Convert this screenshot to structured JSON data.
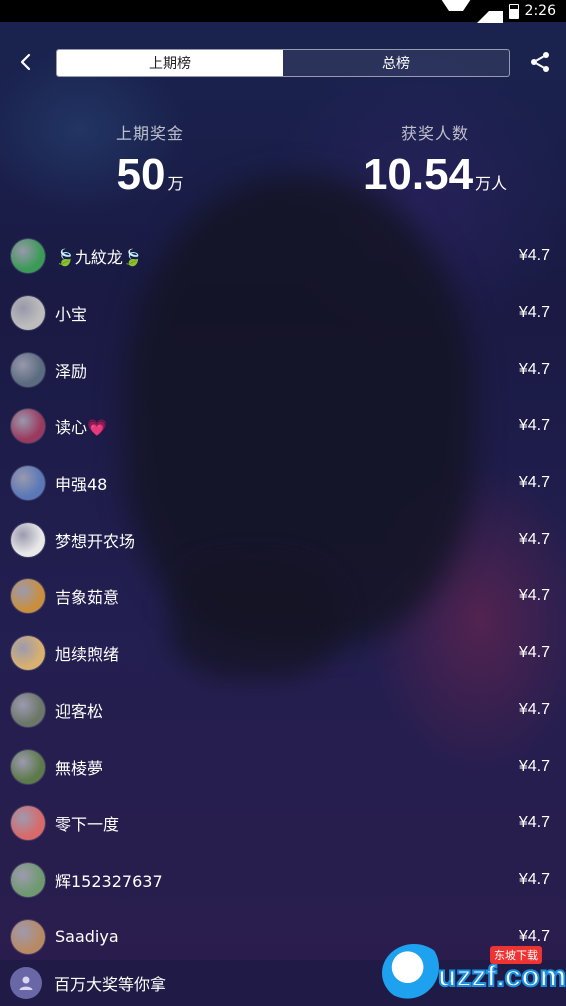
{
  "status_bar": {
    "time": "2:26"
  },
  "header": {
    "tabs": [
      {
        "label": "上期榜",
        "active": true
      },
      {
        "label": "总榜",
        "active": false
      }
    ]
  },
  "stats": {
    "prize": {
      "label": "上期奖金",
      "value": "50",
      "unit": "万"
    },
    "winners": {
      "label": "获奖人数",
      "value": "10.54",
      "unit": "万人"
    }
  },
  "winners": [
    {
      "name": "🍃九紋龙🍃",
      "amount": "¥4.7",
      "avatar_color": "#3b9a57"
    },
    {
      "name": "小宝",
      "amount": "¥4.7",
      "avatar_color": "#bdbdbd"
    },
    {
      "name": "泽励",
      "amount": "¥4.7",
      "avatar_color": "#5b6c80"
    },
    {
      "name": "读心💗",
      "amount": "¥4.7",
      "avatar_color": "#9a3a5e"
    },
    {
      "name": "申强48",
      "amount": "¥4.7",
      "avatar_color": "#5a78b8"
    },
    {
      "name": "梦想开农场",
      "amount": "¥4.7",
      "avatar_color": "#e8e8e8"
    },
    {
      "name": "吉象茹意",
      "amount": "¥4.7",
      "avatar_color": "#c98f3e"
    },
    {
      "name": "旭续煦绪",
      "amount": "¥4.7",
      "avatar_color": "#d8b070"
    },
    {
      "name": "迎客松",
      "amount": "¥4.7",
      "avatar_color": "#6c7768"
    },
    {
      "name": "無棱夢",
      "amount": "¥4.7",
      "avatar_color": "#5d7a4a"
    },
    {
      "name": "零下一度",
      "amount": "¥4.7",
      "avatar_color": "#d86a6a"
    },
    {
      "name": "辉152327637",
      "amount": "¥4.7",
      "avatar_color": "#6f9a70"
    },
    {
      "name": "Saadiya",
      "amount": "¥4.7",
      "avatar_color": "#b88a64"
    }
  ],
  "bottom_bar": {
    "text": "百万大奖等你拿"
  },
  "watermark": {
    "text": "uzzf.com",
    "tag": "东坡下载"
  }
}
